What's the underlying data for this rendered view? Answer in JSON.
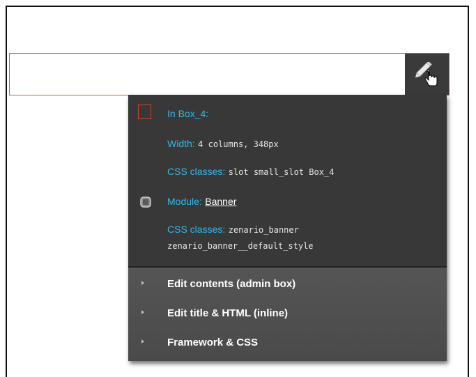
{
  "slot_info": {
    "box_label": "In Box_4:",
    "width_label": "Width:",
    "width_value": "4 columns, 348px",
    "css_label": "CSS classes:",
    "css_value": "slot small_slot Box_4"
  },
  "module_info": {
    "module_label": "Module:",
    "module_name": "Banner",
    "css_label": "CSS classes:",
    "css_value_line1": "zenario_banner",
    "css_value_line2": "zenario_banner__default_style"
  },
  "actions": [
    {
      "label": "Edit contents (admin box)"
    },
    {
      "label": "Edit title & HTML (inline)"
    },
    {
      "label": "Framework & CSS"
    }
  ],
  "colors": {
    "slot_border": "#e0512f",
    "label": "#35b8e6",
    "menu_bg": "#383838"
  },
  "icons": {
    "edit": "pencil-icon",
    "cursor": "hand-pointer-icon",
    "box": "box-outline-icon",
    "module": "module-icon",
    "expand": "triangle-right-icon"
  }
}
